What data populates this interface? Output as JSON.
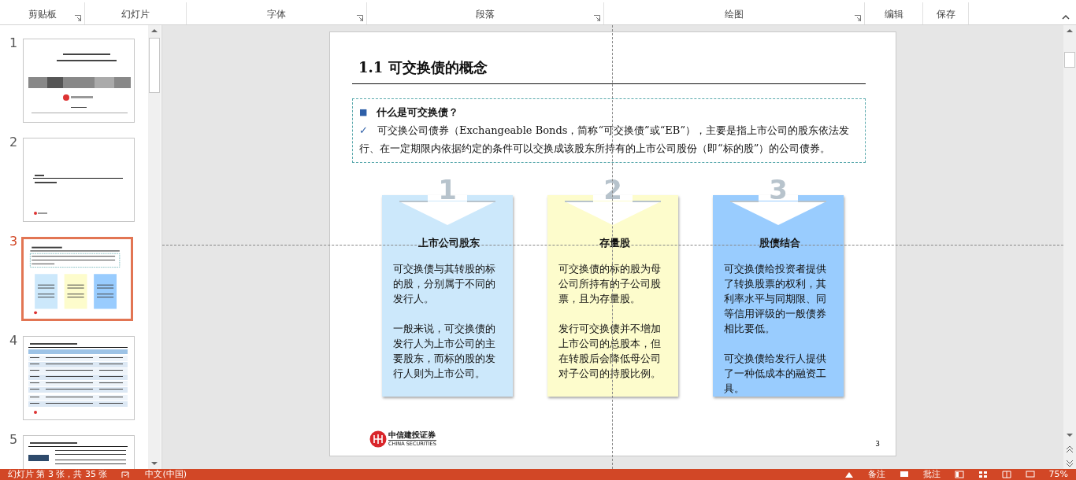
{
  "ribbon": {
    "groups": [
      {
        "label": "剪贴板",
        "launcher": true
      },
      {
        "label": "幻灯片",
        "launcher": false
      },
      {
        "label": "字体",
        "launcher": true
      },
      {
        "label": "段落",
        "launcher": true
      },
      {
        "label": "绘图",
        "launcher": true
      },
      {
        "label": "编辑",
        "launcher": false
      },
      {
        "label": "保存",
        "launcher": false
      }
    ]
  },
  "thumbnails": [
    {
      "number": "1",
      "selected": false
    },
    {
      "number": "2",
      "selected": false
    },
    {
      "number": "3",
      "selected": true
    },
    {
      "number": "4",
      "selected": false
    },
    {
      "number": "5",
      "selected": false
    }
  ],
  "slide": {
    "title": "1.1 可交换债的概念",
    "section": {
      "bullet": "■",
      "heading": "什么是可交换债？",
      "check": "✓",
      "body": "可交换公司债券（Exchangeable Bonds，简称“可交换债”或“EB”），主要是指上市公司的股东依法发行、在一定期限内依据约定的条件可以交换成该股东所持有的上市公司股份（即“标的股”）的公司债券。"
    },
    "cards": [
      {
        "number": "1",
        "title": "上市公司股东",
        "color": "#cce8fb",
        "paragraphs": [
          "可交换债与其转股的标的股，分别属于不同的发行人。",
          "一般来说，可交换债的发行人为上市公司的主要股东，而标的股的发行人则为上市公司。"
        ]
      },
      {
        "number": "2",
        "title": "存量股",
        "color": "#fdfccc",
        "paragraphs": [
          "可交换债的标的股为母公司所持有的子公司股票，且为存量股。",
          "发行可交换债并不增加上市公司的总股本，但在转股后会降低母公司对子公司的持股比例。"
        ]
      },
      {
        "number": "3",
        "title": "股债结合",
        "color": "#99ccfe",
        "paragraphs": [
          "可交换债给投资者提供了转换股票的权利，其利率水平与同期限、同等信用评级的一般债券相比要低。",
          "可交换债给发行人提供了一种低成本的融资工具。"
        ]
      }
    ],
    "logo": {
      "name": "中信建投证券",
      "name_en": "CHINA SECURITIES"
    },
    "page_number": "3"
  },
  "status_bar": {
    "slide_info": "幻灯片 第 3 张，共 35 张",
    "language": "中文(中国)",
    "notes": "备注",
    "comments": "批注",
    "zoom": "75%"
  }
}
